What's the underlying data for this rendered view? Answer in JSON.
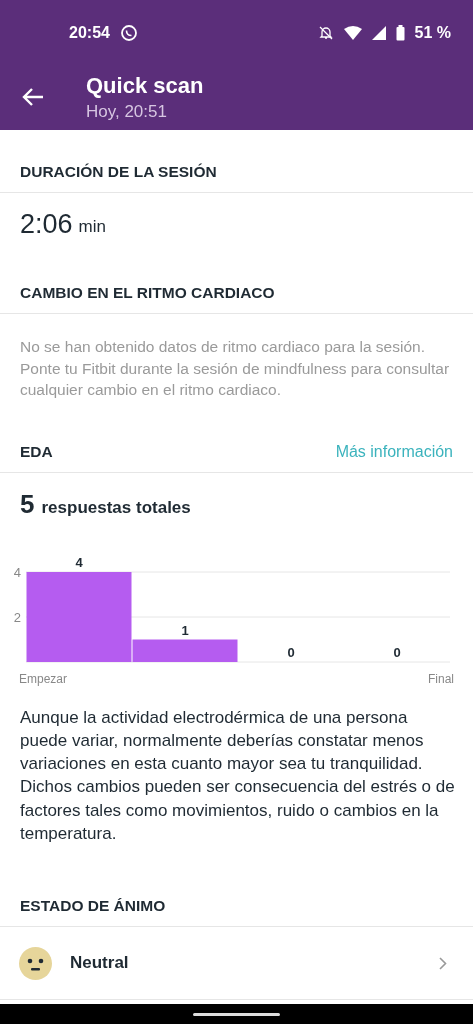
{
  "status_bar": {
    "time": "20:54",
    "battery": "51 %"
  },
  "header": {
    "title": "Quick scan",
    "subtitle": "Hoy, 20:51"
  },
  "duration": {
    "heading": "DURACIÓN DE LA SESIÓN",
    "value": "2:06",
    "unit": "min"
  },
  "heart_rate": {
    "heading": "CAMBIO EN EL RITMO CARDIACO",
    "message": "No se han obtenido datos de ritmo cardiaco para la sesión. Ponte tu Fitbit durante la sesión de mindfulness para consultar cualquier cambio en el ritmo cardiaco."
  },
  "eda": {
    "heading": "EDA",
    "link": "Más información",
    "count": "5",
    "count_label": "respuestas totales",
    "chart_data": {
      "type": "bar",
      "categories": [
        "Empezar",
        null,
        null,
        "Final"
      ],
      "series": [
        {
          "color": "#b55cf0",
          "values": [
            4,
            1,
            0,
            0
          ]
        }
      ],
      "ylim": [
        0,
        4
      ],
      "yticks": [
        2,
        4
      ],
      "value_labels": [
        "4",
        "1",
        "0",
        "0"
      ]
    },
    "description": "Aunque la actividad electrodérmica de una persona puede variar, normalmente deberías constatar menos variaciones en esta cuanto mayor sea tu tranquilidad. Dichos cambios pueden ser consecuencia del estrés o de factores tales como movimientos, ruido o cambios en la temperatura."
  },
  "mood": {
    "heading": "ESTADO DE ÁNIMO",
    "value": "Neutral"
  }
}
